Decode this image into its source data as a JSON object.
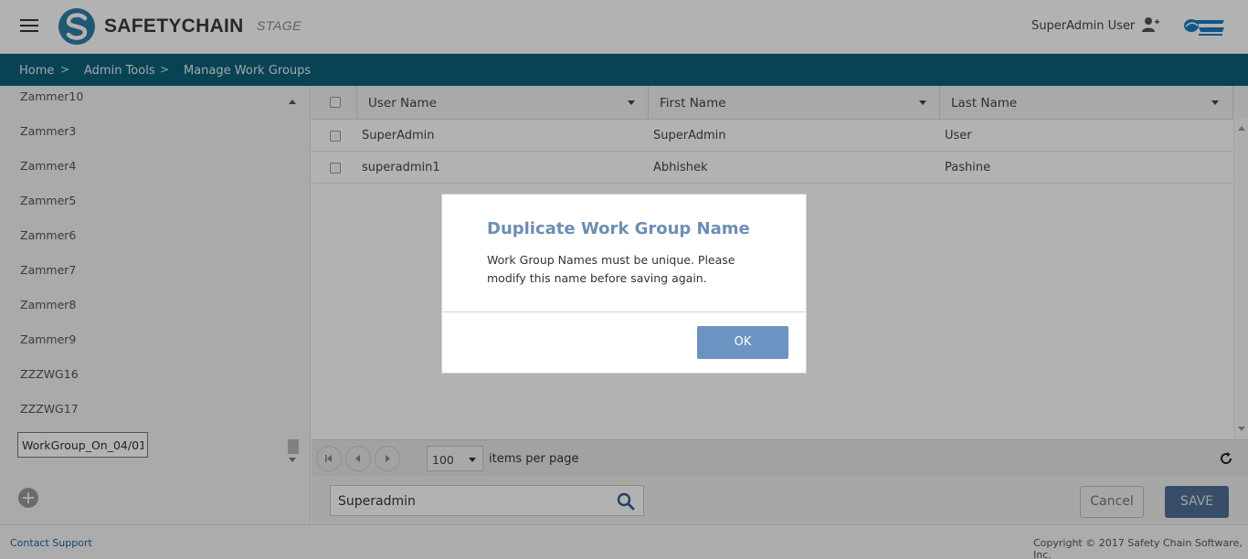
{
  "header": {
    "logo_text": "SAFETYCHAIN",
    "env_label": "STAGE",
    "user_name": "SuperAdmin User"
  },
  "breadcrumb": {
    "items": [
      "Home",
      "Admin Tools",
      "Manage Work Groups"
    ],
    "separator": ">"
  },
  "sidebar": {
    "partial_top_item": "Zammer10",
    "items": [
      "Zammer3",
      "Zammer4",
      "Zammer5",
      "Zammer6",
      "Zammer7",
      "Zammer8",
      "Zammer9",
      "ZZZWG16",
      "ZZZWG17"
    ],
    "editing_value": "WorkGroup_On_04/01"
  },
  "grid": {
    "columns": [
      "User Name",
      "First Name",
      "Last Name"
    ],
    "rows": [
      {
        "user_name": "SuperAdmin",
        "first_name": "SuperAdmin",
        "last_name": "User"
      },
      {
        "user_name": "superadmin1",
        "first_name": "Abhishek",
        "last_name": "Pashine"
      }
    ]
  },
  "pager": {
    "page_size": "100",
    "items_per_page_label": "items per page"
  },
  "search": {
    "value": "Superadmin"
  },
  "actions": {
    "cancel_label": "Cancel",
    "save_label": "SAVE"
  },
  "footer": {
    "support_link": "Contact Support",
    "copyright": "Copyright © 2017 Safety Chain Software, Inc."
  },
  "modal": {
    "title": "Duplicate Work Group Name",
    "message": "Work Group Names must be unique. Please modify this name before saving again.",
    "ok_label": "OK"
  },
  "colors": {
    "breadcrumb_bg": "#0c6079",
    "save_button": "#4f6f96",
    "ok_button": "#6c93c2",
    "modal_title": "#6c8fb3"
  },
  "icons": [
    "menu-icon",
    "safetychain-logo-icon",
    "user-icon",
    "brand-logo-icon",
    "sort-arrow-icon",
    "add-icon",
    "search-icon",
    "refresh-icon",
    "first-page-icon",
    "prev-page-icon",
    "next-page-icon"
  ]
}
